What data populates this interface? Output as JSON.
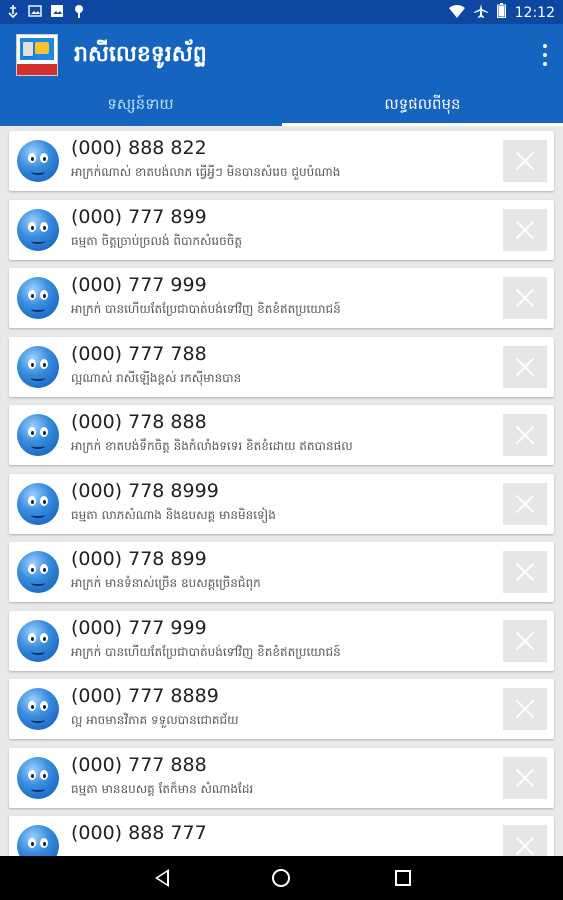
{
  "status_bar": {
    "time": "12:12",
    "left_icons": [
      "usb-icon",
      "image-icon",
      "gallery-icon",
      "pin-icon"
    ],
    "right_icons": [
      "wifi-icon",
      "airplane-icon",
      "battery-icon"
    ]
  },
  "app_bar": {
    "title": "រាសីលេខទូរស័ព្ទ",
    "logo_text": "រាសីលេខទូរស័ព្ទ"
  },
  "tabs": [
    {
      "label": "ទស្សន៍ទាយ",
      "selected": false
    },
    {
      "label": "លទ្ធផលពីមុន",
      "selected": true
    }
  ],
  "colors": {
    "status_bar": "#0d47a1",
    "app_bar": "#1565c0",
    "list_bg": "#e9e9e9"
  },
  "results": [
    {
      "number": "(000) 888 822",
      "desc": "អាក្រក់ណាស់ ខាតបង់លាភ ធ្វើអ្វីៗ មិនបានសំរេច ជួបបំណាង",
      "icon": "worried-emoji-icon"
    },
    {
      "number": "(000) 777 899",
      "desc": "ធម្មតា ចិត្តច្រាប់ច្រលង់ ពិបាកសំរេចចិត្ត",
      "icon": "neutral-emoji-icon"
    },
    {
      "number": "(000) 777 999",
      "desc": "អាក្រក់ បានហើយតែប្រែជាបាត់បង់ទៅវិញ ខិតខំឥតប្រយោជន៍",
      "icon": "sad-emoji-icon"
    },
    {
      "number": "(000) 777 788",
      "desc": "ល្អណាស់ រាសីឡើងខ្ពស់ រកស៊ីមានបាន",
      "icon": "laughing-emoji-icon"
    },
    {
      "number": "(000) 778 888",
      "desc": "អាក្រក់ ខាតបង់ទឹកចិត្ត និងកំលាំងទទេរ ខិតខំដោយ ឥតបានផល",
      "icon": "sunglasses-emoji-icon"
    },
    {
      "number": "(000) 778 8999",
      "desc": "ធម្មតា លាភសំណាង និងឧបសគ្គ មានមិនទៀង",
      "icon": "neutral-emoji-icon"
    },
    {
      "number": "(000) 778 899",
      "desc": "អាក្រក់ មានទំនាស់ច្រើន ឧបសគ្គច្រើនជំពុក",
      "icon": "sad-emoji-icon"
    },
    {
      "number": "(000) 777 999",
      "desc": "អាក្រក់ បានហើយតែប្រែជាបាត់បង់ទៅវិញ ខិតខំឥតប្រយោជន៍",
      "icon": "shocked-emoji-icon"
    },
    {
      "number": "(000) 777 8889",
      "desc": "ល្អ អាចមានវិភាគ ទទួលបានជោគជ័យ",
      "icon": "sad-emoji-icon"
    },
    {
      "number": "(000) 777 888",
      "desc": "ធម្មតា មានឧបសគ្គ តែក៏មាន សំណាងដែរ",
      "icon": "neutral-emoji-icon"
    },
    {
      "number": "(000) 888 777",
      "desc": "",
      "icon": "neutral-emoji-icon"
    }
  ],
  "nav_bar": [
    "back-icon",
    "home-icon",
    "recents-icon"
  ]
}
